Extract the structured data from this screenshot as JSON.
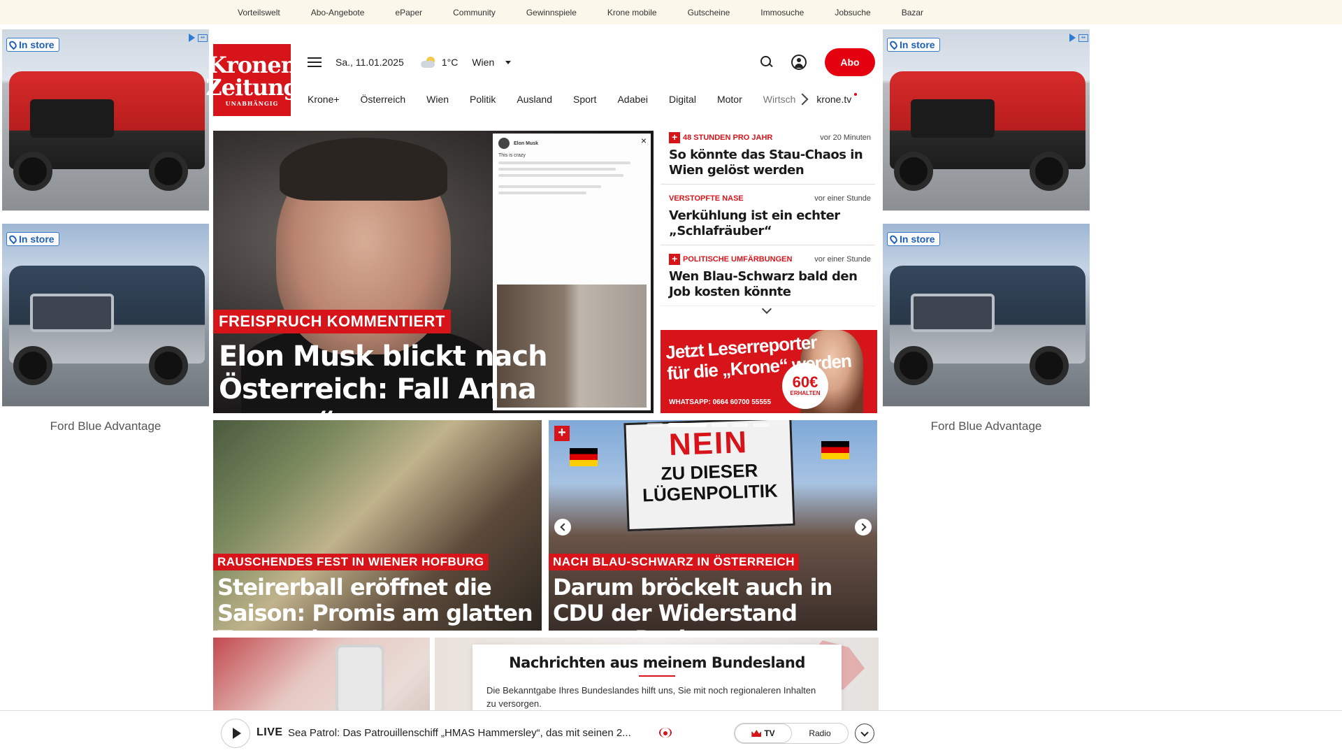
{
  "topbar": {
    "links": [
      "Vorteilswelt",
      "Abo-Angebote",
      "ePaper",
      "Community",
      "Gewinnspiele",
      "Krone mobile",
      "Gutscheine",
      "Immosuche",
      "Jobsuche",
      "Bazar"
    ]
  },
  "ads": {
    "badge": "In store",
    "caption": "Ford Blue Advantage"
  },
  "header": {
    "logo_line1": "Kronen",
    "logo_line2": "Zeitung",
    "logo_line3": "UNABHÄNGIG",
    "date": "Sa., 11.01.2025",
    "temperature": "1°C",
    "city": "Wien",
    "abo_label": "Abo"
  },
  "nav": {
    "items": [
      "Krone+",
      "Österreich",
      "Wien",
      "Politik",
      "Ausland",
      "Sport",
      "Adabei",
      "Digital",
      "Motor"
    ],
    "cut_item": "Wirtsch",
    "tv_item": "krone.tv"
  },
  "hero": {
    "kicker": "FREISPRUCH KOMMENTIERT",
    "title": "Elon Musk blickt nach Österreich: Fall Anna „crazy“",
    "tweet_name": "Elon Musk",
    "tweet_text": "This is crazy"
  },
  "ticker": {
    "items": [
      {
        "kicker": "48 STUNDEN PRO JAHR",
        "time": "vor 20 Minuten",
        "title": "So könnte das Stau-Chaos in Wien gelöst werden",
        "plus": true
      },
      {
        "kicker": "VERSTOPFTE NASE",
        "time": "vor einer Stunde",
        "title": "Verkühlung ist ein echter „Schlafräuber“",
        "plus": false
      },
      {
        "kicker": "POLITISCHE UMFÄRBUNGEN",
        "time": "vor einer Stunde",
        "title": "Wen Blau-Schwarz bald den Job kosten könnte",
        "plus": true
      }
    ]
  },
  "leserreporter": {
    "line1": "Jetzt Leserreporter",
    "line2": "für die „Krone“ werden",
    "whatsapp": "WHATSAPP: 0664 60700 55555",
    "amount": "60€",
    "amount_sub": "ERHALTEN"
  },
  "tiles": [
    {
      "kicker": "RAUSCHENDES FEST IN WIENER HOFBURG",
      "title": "Steirerball eröffnet die Saison: Promis am glatten Tanzparkett"
    },
    {
      "kicker": "NACH BLAU-SCHWARZ IN ÖSTERREICH",
      "title": "Darum bröckelt auch in CDU der Widerstand gegen Rechts",
      "sign_line1": "NEIN",
      "sign_line2": "ZU DIESER",
      "sign_line3": "LÜGENPOLITIK"
    }
  ],
  "bundesland": {
    "title": "Nachrichten aus meinem Bundesland",
    "text": "Die Bekanntgabe Ihres Bundeslandes hilft uns, Sie mit noch regionaleren Inhalten zu versorgen."
  },
  "livebar": {
    "label": "LIVE",
    "text": "Sea Patrol: Das Patrouillenschiff „HMAS Hammersley“, das mit seinen 2...",
    "tv_label": "TV",
    "radio_label": "Radio"
  },
  "colors": {
    "brand_red": "#d7141a",
    "abo_red": "#e3000f",
    "topbar_bg": "#fbf7ea"
  }
}
